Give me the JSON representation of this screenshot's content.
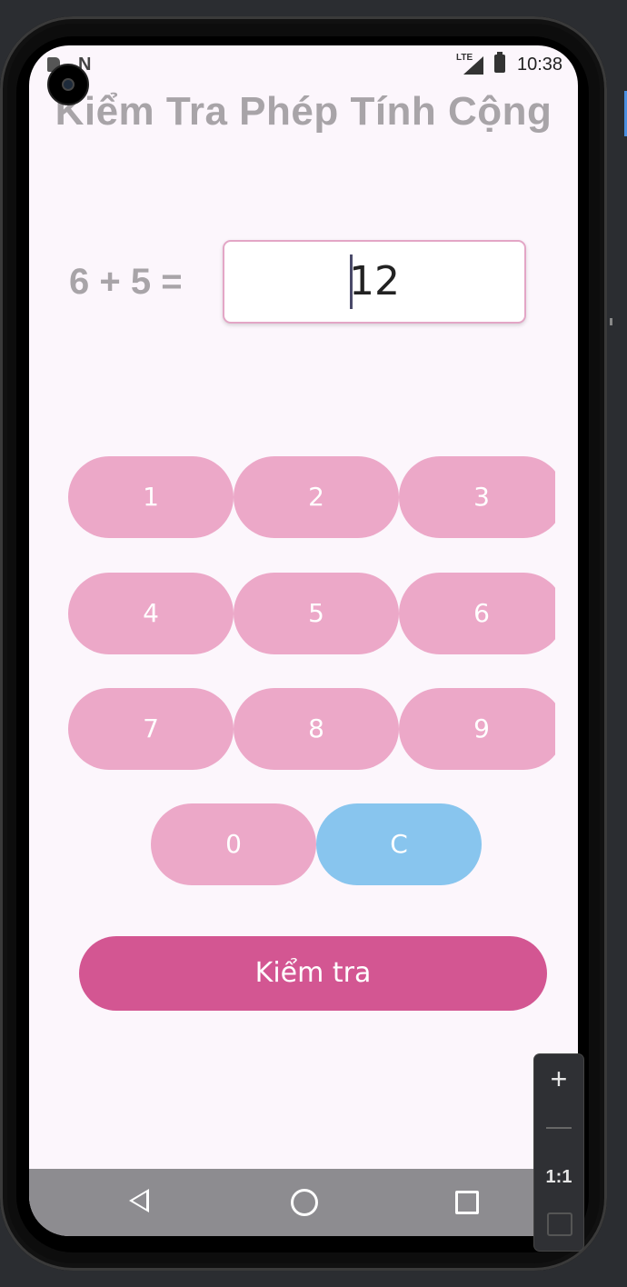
{
  "status_bar": {
    "network": "LTE",
    "time": "10:38",
    "icons": [
      "sd-card-icon",
      "n-notification-icon",
      "signal-icon",
      "battery-icon"
    ]
  },
  "app": {
    "title": "Kiểm Tra Phép Tính Cộng",
    "equation": "6 + 5 =",
    "answer_value": "12",
    "keypad": {
      "rows": [
        [
          "1",
          "2",
          "3"
        ],
        [
          "4",
          "5",
          "6"
        ],
        [
          "7",
          "8",
          "9"
        ],
        [
          "0",
          "C"
        ]
      ]
    },
    "check_label": "Kiểm tra"
  },
  "navigation": {
    "icons": [
      "back-icon",
      "home-icon",
      "recents-icon"
    ]
  },
  "emulator_zoom": {
    "zoom_in": "+",
    "zoom_out": "−",
    "ratio": "1:1"
  },
  "colors": {
    "background": "#fcf6fc",
    "key_pink": "#eca8c8",
    "key_blue": "#88c5ee",
    "button_primary": "#d35692",
    "title_gray": "#a8a4a8",
    "nav_bar": "#8d8c90"
  }
}
